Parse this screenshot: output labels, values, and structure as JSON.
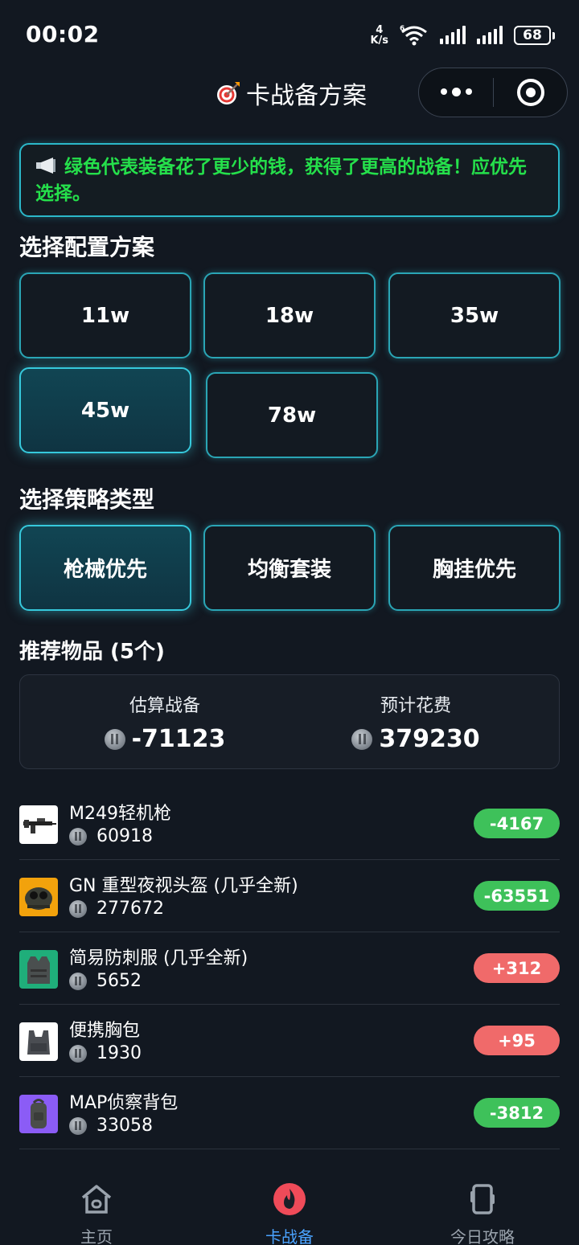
{
  "status_bar": {
    "time": "00:02",
    "net_speed_value": "4",
    "net_speed_unit": "K/s",
    "wifi_label": "6",
    "battery": "68"
  },
  "header": {
    "title": "卡战备方案",
    "title_icon": "dart-target-icon",
    "more_icon": "more-dots-icon",
    "close_icon": "target-circle-icon"
  },
  "notice": {
    "icon": "speaker-icon",
    "text": "绿色代表装备花了更少的钱，获得了更高的战备！应优先选择。",
    "color": "#25e04b"
  },
  "config": {
    "title": "选择配置方案",
    "options": [
      "11w",
      "18w",
      "35w",
      "45w",
      "78w"
    ],
    "selected": "45w"
  },
  "strategy": {
    "title": "选择策略类型",
    "options": [
      "枪械优先",
      "均衡套装",
      "胸挂优先"
    ],
    "selected": "枪械优先"
  },
  "recommend": {
    "title": "推荐物品 (5个)",
    "summary": {
      "readiness_label": "估算战备",
      "readiness_value": "-71123",
      "cost_label": "预计花费",
      "cost_value": "379230"
    },
    "items": [
      {
        "name": "M249轻机枪",
        "price": "60918",
        "delta": "-4167",
        "status": "green",
        "thumb_bg": "#ffffff"
      },
      {
        "name": "GN 重型夜视头盔 (几乎全新)",
        "price": "277672",
        "delta": "-63551",
        "status": "green",
        "thumb_bg": "#f2a20c"
      },
      {
        "name": "简易防刺服 (几乎全新)",
        "price": "5652",
        "delta": "+312",
        "status": "red",
        "thumb_bg": "#1fae7a"
      },
      {
        "name": "便携胸包",
        "price": "1930",
        "delta": "+95",
        "status": "red",
        "thumb_bg": "#ffffff"
      },
      {
        "name": "MAP侦察背包",
        "price": "33058",
        "delta": "-3812",
        "status": "green",
        "thumb_bg": "#8b5cf6"
      }
    ]
  },
  "tabbar": {
    "items": [
      {
        "label": "主页",
        "icon": "home-icon"
      },
      {
        "label": "卡战备",
        "icon": "fire-icon",
        "active": true
      },
      {
        "label": "今日攻略",
        "icon": "phone-guide-icon"
      }
    ]
  },
  "colors": {
    "accent": "#2bb8c9",
    "green": "#3ec15a",
    "red": "#f06a6a",
    "tab_active": "#4aa3ff"
  }
}
